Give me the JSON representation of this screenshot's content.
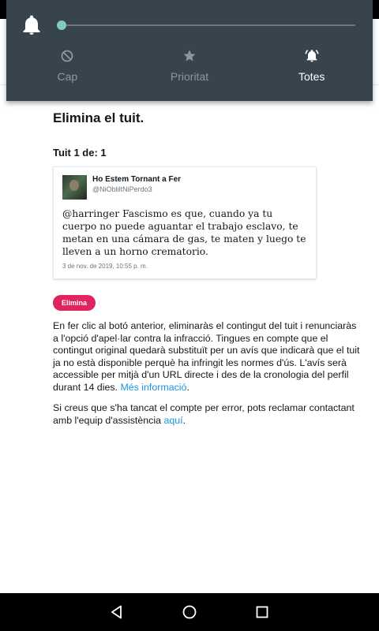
{
  "notification_panel": {
    "tabs": [
      {
        "label": "Cap",
        "icon": "block-icon"
      },
      {
        "label": "Prioritat",
        "icon": "star-icon"
      },
      {
        "label": "Totes",
        "icon": "alarm-bell-icon"
      }
    ],
    "slider_level": 0
  },
  "page": {
    "title": "Elimina el tuit.",
    "counter": "Tuit 1 de: 1",
    "tweet": {
      "display_name": "Ho Estem Tornant a Fer",
      "handle": "@NiObliltNiPerdo3",
      "text": "@harringer Fascismo es que, cuando ya tu cuerpo no puede aguantar el trabajo esclavo, te metan en una cámara de gas, te maten y luego te lleven a un horno crematorio.",
      "time": "3 de nov. de 2019, 10:55 p. m."
    },
    "delete_button": "Elimina",
    "paragraph1": "En fer clic al botó anterior, eliminaràs el contingut del tuit i renunciaràs a l'opció d'apel·lar contra la infracció. Tingues en compte que el contingut original quedarà substituït per un avís que indicarà que el tuit ja no està disponible perquè ha infringit les normes d'ús. L'avís serà accessible per mitjà d'un URL directe i des de la cronologia del perfil durant 14 dies.",
    "more_info_link": "Més informació",
    "paragraph1_end": ".",
    "paragraph2": "Si creus que s'ha tancat el compte per error, pots reclamar contactant amb l'equip d'assistència",
    "here_link": "aquí",
    "paragraph2_end": "."
  },
  "colors": {
    "panel_bg": "#37434d",
    "accent": "#80cbc4",
    "delete_button": "#e0245e",
    "link": "#1b95e0"
  }
}
